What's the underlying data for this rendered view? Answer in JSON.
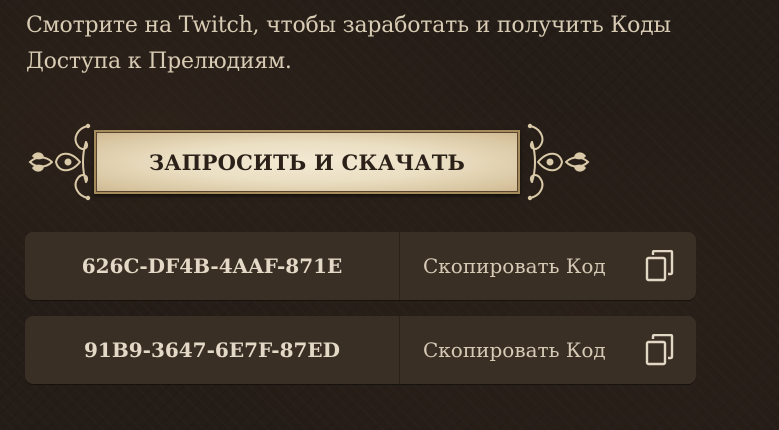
{
  "description": "Смотрите на Twitch, чтобы заработать и получить Коды Доступа к Прелюдиям.",
  "request_button": {
    "label": "ЗАПРОСИТЬ И СКАЧАТЬ"
  },
  "codes": [
    {
      "value": "626C-DF4B-4AAF-871E",
      "copy_label": "Скопировать Код",
      "icon": "copy-icon"
    },
    {
      "value": "91B9-3647-6E7F-87ED",
      "copy_label": "Скопировать Код",
      "icon": "copy-icon"
    }
  ],
  "colors": {
    "background": "#241c16",
    "text": "#d8cbb4",
    "button_fill": "#ebdfc3",
    "button_text": "#2b2119",
    "code_row": "#3a2f25",
    "ornament": "#d9c9a8"
  }
}
